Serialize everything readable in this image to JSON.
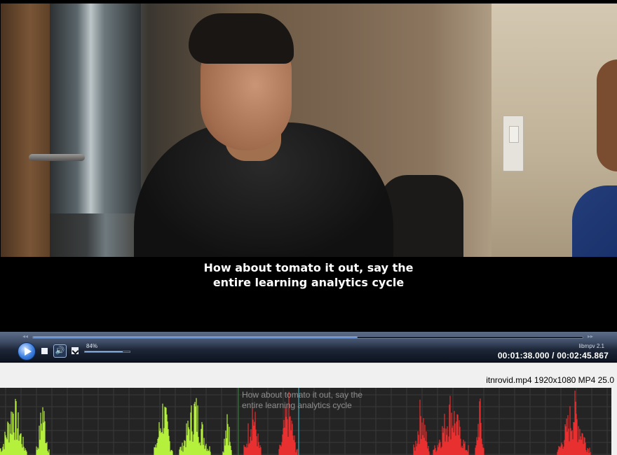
{
  "video": {
    "subtitle_lines": [
      "How about tomato it out, say the",
      "entire learning analytics cycle"
    ]
  },
  "player": {
    "progress_fraction": 0.5906,
    "volume_label": "84%",
    "volume_fraction": 0.84,
    "engine_label": "libmpv 2.1",
    "time_display": "00:01:38.000 / 00:02:45.867",
    "seek_left_glyph": "◂◂",
    "seek_right_glyph": "▸▸",
    "volume_icon_glyph": "🔊"
  },
  "status": {
    "file_info": "itnrovid.mp4 1920x1080 MP4 25.0"
  },
  "waveform": {
    "subtitle_lines": [
      "How about tomato it out, say the",
      "entire learning analytics cycle"
    ],
    "colors": {
      "background": "#242424",
      "grid": "#3a3a3a",
      "past": "#b4f03c",
      "selected": "#e83030",
      "cursor": "#3cc8d8",
      "selection_start": "#2e6b2e"
    }
  }
}
